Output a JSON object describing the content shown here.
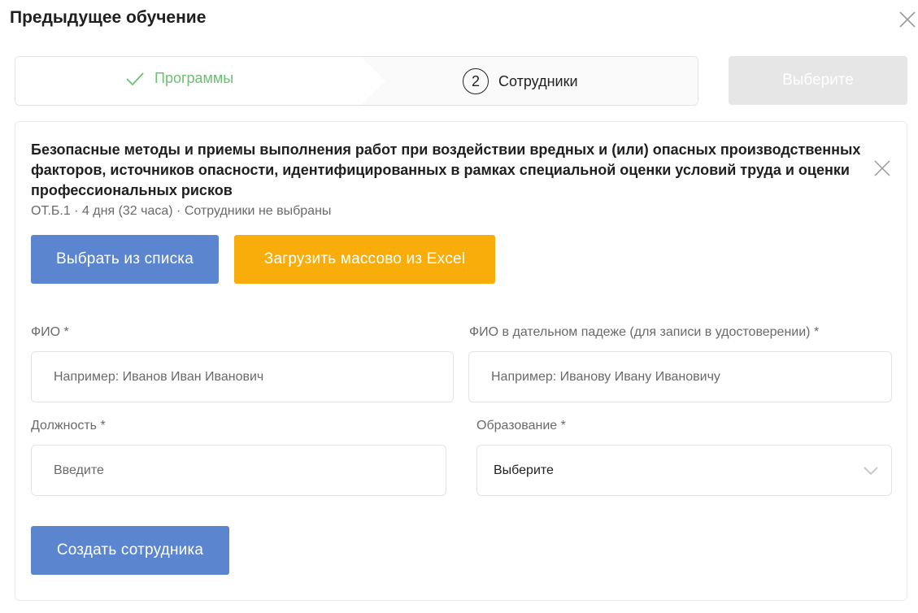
{
  "modal": {
    "title": "Предыдущее обучение"
  },
  "stepper": {
    "steps": [
      {
        "label": "Программы",
        "state": "done"
      },
      {
        "number": "2",
        "label": "Сотрудники",
        "state": "active"
      }
    ]
  },
  "header": {
    "select_button": "Выберите"
  },
  "course": {
    "title": "Безопасные методы и приемы выполнения работ при воздействии вредных и (или) опасных производственных факторов, источников опасности, идентифицированных в рамках специальной оценки условий труда и оценки профессиональных рисков",
    "meta": "ОТ.Б.1 · 4 дня (32 часа) · Сотрудники не выбраны"
  },
  "actions": {
    "choose_from_list": "Выбрать из списка",
    "bulk_upload": "Загрузить массово из Excel",
    "create_employee": "Создать сотрудника"
  },
  "form": {
    "fio": {
      "label": "ФИО *",
      "placeholder": "Например: Иванов Иван Иванович",
      "value": ""
    },
    "fio_dative": {
      "label": "ФИО в дательном падеже (для записи в удостоверении) *",
      "placeholder": "Например: Иванову Ивану Ивановичу",
      "value": ""
    },
    "position": {
      "label": "Должность *",
      "placeholder": "Введите",
      "value": ""
    },
    "education": {
      "label": "Образование *",
      "selected": "Выберите"
    }
  },
  "colors": {
    "primary_blue": "#5b86cf",
    "accent_orange": "#f8ad0a",
    "success_green": "#6dbf73",
    "disabled_gray": "#e6e6e6"
  },
  "icons": {
    "close": "close-icon",
    "check": "check-icon",
    "chevron": "chevron-down-icon"
  }
}
